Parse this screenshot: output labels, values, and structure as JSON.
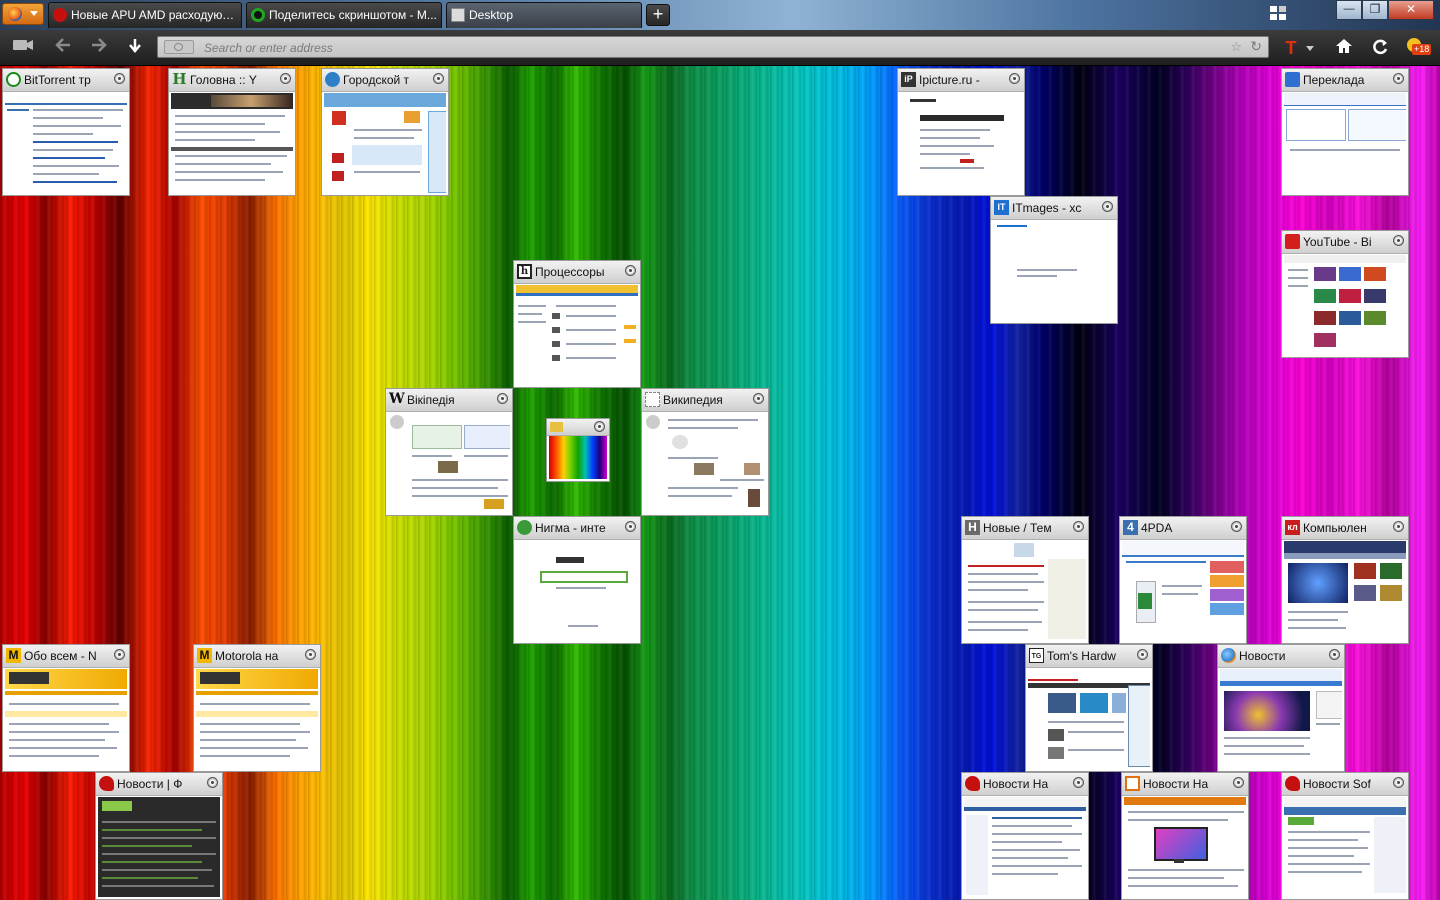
{
  "window": {
    "tabs": [
      {
        "label": "Новые APU AMD расходуют ...",
        "favicon": "amd-red-icon",
        "color": "#c4100e",
        "active": false
      },
      {
        "label": "Поделитесь скриншотом - M...",
        "favicon": "green-circle-icon",
        "color": "#1fa81f",
        "active": false
      },
      {
        "label": "Desktop",
        "favicon": "desktop-icon",
        "color": "#dcdcdc",
        "active": true
      }
    ],
    "new_tab_label": "+",
    "controls": {
      "minimize": "—",
      "maximize": "❐",
      "close": "✕"
    }
  },
  "navbar": {
    "address_placeholder": "Search or enter address",
    "toolbar_icons": [
      "camera-icon",
      "back-icon",
      "forward-icon",
      "download-icon",
      "translate-icon",
      "home-icon",
      "reload-icon",
      "weather-icon"
    ],
    "weather_badge": "+18"
  },
  "desktop": {
    "tab_items": [
      {
        "title": "BitTorrent тр",
        "icon": "bittorrent-icon",
        "icon_text": "",
        "icon_color": "#1a8a1a",
        "theme": "#3a6fb0",
        "size": "normal"
      },
      {
        "title": "Головна :: Y",
        "icon": "h-letter-icon",
        "icon_text": "H",
        "icon_color": "#2a7a2a",
        "theme": "#2b2b2b",
        "size": "normal"
      },
      {
        "title": "Городской т",
        "icon": "globe-icon",
        "icon_text": "",
        "icon_color": "#2f7fc8",
        "theme": "#6aa8dc",
        "size": "normal"
      },
      {
        "title": "Ipicture.ru -",
        "icon": "ipicture-icon",
        "icon_text": "iP",
        "icon_color": "#333333",
        "theme": "#2a2a2a",
        "size": "normal"
      },
      {
        "title": "Переклада",
        "icon": "translator-icon",
        "icon_text": "",
        "icon_color": "#2f6fd0",
        "theme": "#3a6fc8",
        "size": "normal"
      },
      {
        "title": "ITmages - xc",
        "icon": "itmages-icon",
        "icon_text": "IT",
        "icon_color": "#1f6fd0",
        "theme": "#ffffff",
        "size": "normal"
      },
      {
        "title": "YouTube - Вi",
        "icon": "youtube-icon",
        "icon_text": "",
        "icon_color": "#d41e1e",
        "theme": "#cc2020",
        "size": "normal"
      },
      {
        "title": "Процессоры",
        "icon": "h-box-icon",
        "icon_text": "h",
        "icon_color": "#222222",
        "theme": "#2f6fc0",
        "size": "normal"
      },
      {
        "title": "Вікіпедія",
        "icon": "wikipedia-icon",
        "icon_text": "W",
        "icon_color": "#ffffff",
        "theme": "#f0f0f0",
        "size": "normal"
      },
      {
        "title": "Википедия",
        "icon": "blank-page-icon",
        "icon_text": "",
        "icon_color": "#ffffff",
        "theme": "#f0f0f0",
        "size": "normal"
      },
      {
        "title": "",
        "icon": "folder-icon",
        "icon_text": "",
        "icon_color": "#e8c040",
        "theme": "#30a030",
        "size": "small"
      },
      {
        "title": "Нигма - инте",
        "icon": "nigma-icon",
        "icon_text": "",
        "icon_color": "#3a9a3a",
        "theme": "#ffffff",
        "size": "normal"
      },
      {
        "title": "Новые / Тем",
        "icon": "h-grey-icon",
        "icon_text": "H",
        "icon_color": "#6a6a6a",
        "theme": "#ffffff",
        "size": "normal"
      },
      {
        "title": "4PDA",
        "icon": "4pda-icon",
        "icon_text": "4",
        "icon_color": "#3a6fb0",
        "theme": "#3a7ac8",
        "size": "normal"
      },
      {
        "title": "Компьюлен",
        "icon": "kl-icon",
        "icon_text": "кл",
        "icon_color": "#c81e1e",
        "theme": "#2a3a6a",
        "size": "normal"
      },
      {
        "title": "Обо всем - N",
        "icon": "motorola-m-icon",
        "icon_text": "M",
        "icon_color": "#f0b800",
        "theme": "#f0a800",
        "size": "normal"
      },
      {
        "title": "Motorola на",
        "icon": "motorola-m-icon",
        "icon_text": "M",
        "icon_color": "#f0b800",
        "theme": "#f0a800",
        "size": "normal"
      },
      {
        "title": "Tom's Hardw",
        "icon": "tg-icon",
        "icon_text": "TG",
        "icon_color": "#222222",
        "theme": "#c82020",
        "size": "normal"
      },
      {
        "title": "Новости",
        "icon": "news-globe-icon",
        "icon_text": "",
        "icon_color": "#2f7fd0",
        "theme": "#3a7ad0",
        "size": "normal"
      },
      {
        "title": "Новости | Ф",
        "icon": "amd-red-icon",
        "icon_text": "",
        "icon_color": "#c4100e",
        "theme": "#222222",
        "size": "normal"
      },
      {
        "title": "Новости На",
        "icon": "amd-red-icon",
        "icon_text": "",
        "icon_color": "#c4100e",
        "theme": "#2f5fa0",
        "size": "normal"
      },
      {
        "title": "Новости Ha",
        "icon": "ixbt-icon",
        "icon_text": "",
        "icon_color": "#e07010",
        "theme": "#e07a10",
        "size": "normal"
      },
      {
        "title": "Новости Sof",
        "icon": "amd-red-icon",
        "icon_text": "",
        "icon_color": "#c4100e",
        "theme": "#3a6fb0",
        "size": "normal"
      }
    ]
  }
}
